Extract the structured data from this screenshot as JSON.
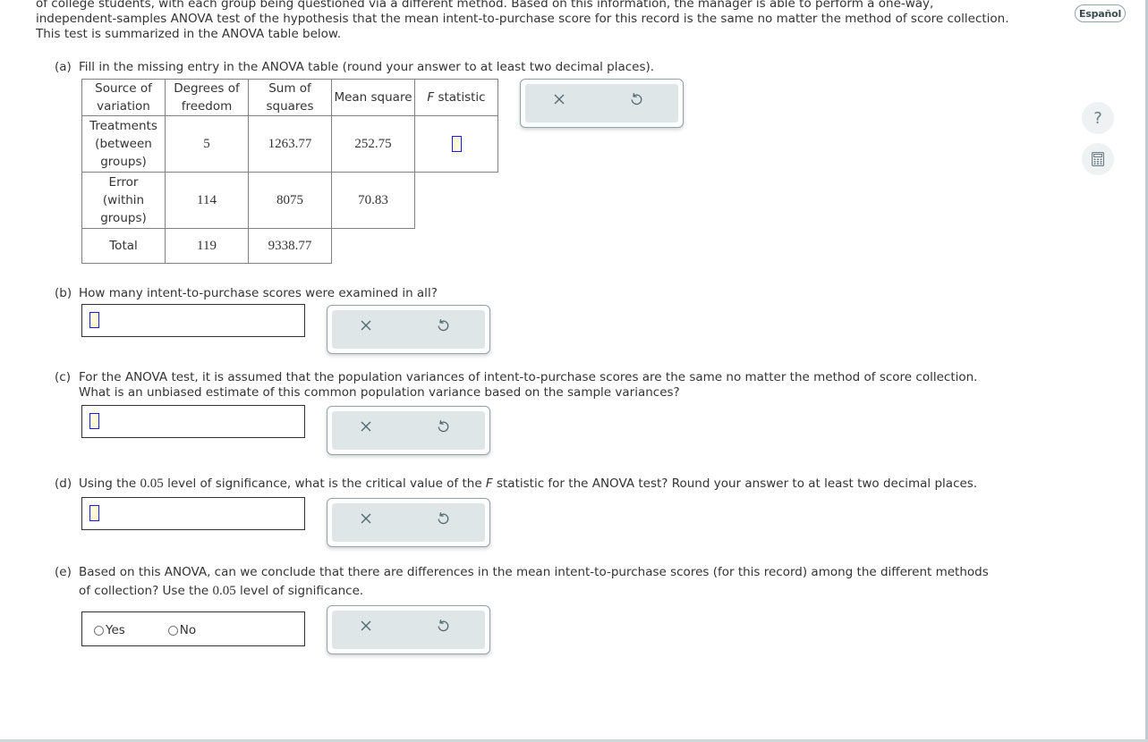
{
  "intro": {
    "line1": "of college students, with each group being questioned via a different method. Based on this information, the manager is able to perform a one-way,",
    "line2": "independent-samples ANOVA test of the hypothesis that the mean intent-to-purchase score for this record is the same no matter the method of score collection.",
    "line3": "This test is summarized in the ANOVA table below."
  },
  "language_button": "Español",
  "side_tools": {
    "help_icon": "?",
    "calculator_icon": "calculator"
  },
  "part_a": {
    "label": "(a)",
    "text": "Fill in the missing entry in the ANOVA table (round your answer to at least two decimal places).",
    "table": {
      "headers": [
        [
          "Source of",
          "variation"
        ],
        [
          "Degrees of",
          "freedom"
        ],
        [
          "Sum of",
          "squares"
        ],
        [
          "Mean square"
        ],
        [
          "F",
          "statistic"
        ]
      ],
      "rows": [
        {
          "source": [
            "Treatments",
            "(between",
            "groups)"
          ],
          "df": "5",
          "ss": "1263.77",
          "ms": "252.75",
          "f": ""
        },
        {
          "source": [
            "Error",
            "(within",
            "groups)"
          ],
          "df": "114",
          "ss": "8075",
          "ms": "70.83"
        },
        {
          "source": [
            "Total"
          ],
          "df": "119",
          "ss": "9338.77"
        }
      ]
    }
  },
  "part_b": {
    "label": "(b)",
    "text": "How many intent-to-purchase scores were examined in all?",
    "answer": ""
  },
  "part_c": {
    "label": "(c)",
    "text1": "For the ANOVA test, it is assumed that the population variances of intent-to-purchase scores are the same no matter the method of score collection.",
    "text2": "What is an unbiased estimate of this common population variance based on the sample variances?",
    "answer": ""
  },
  "part_d": {
    "label": "(d)",
    "text_pre": "Using the",
    "alpha": "0.05",
    "text_mid": "level of significance, what is the critical value of the",
    "f_italic": "F",
    "text_post": "statistic for the ANOVA test? Round your answer to at least two decimal places.",
    "answer": ""
  },
  "part_e": {
    "label": "(e)",
    "text1": "Based on this ANOVA, can we conclude that there are differences in the mean intent-to-purchase scores (for this record) among the different methods",
    "text2_pre": "of collection? Use the",
    "alpha": "0.05",
    "text2_post": "level of significance.",
    "options": [
      "Yes",
      "No"
    ],
    "selected": null
  },
  "tools": {
    "clear_icon": "×",
    "undo_icon": "undo"
  }
}
